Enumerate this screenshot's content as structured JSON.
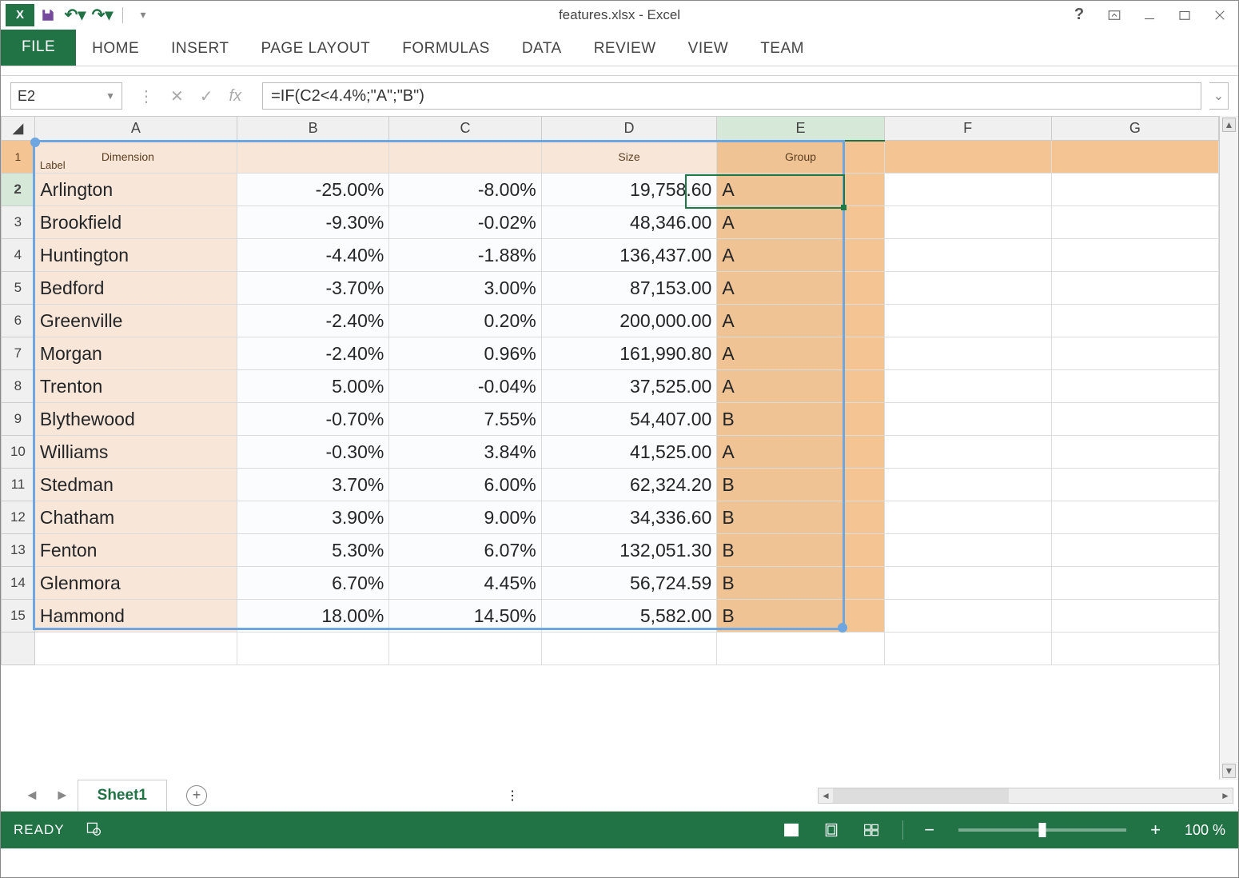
{
  "window": {
    "title": "features.xlsx - Excel"
  },
  "qat": {
    "save": "Save",
    "undo": "Undo",
    "redo": "Redo"
  },
  "titlebar_buttons": {
    "help": "?",
    "ribbon_opts": "Ribbon Display Options",
    "min": "Minimize",
    "restore": "Restore",
    "close": "Close"
  },
  "ribbon": {
    "tabs": [
      "FILE",
      "HOME",
      "INSERT",
      "PAGE LAYOUT",
      "FORMULAS",
      "DATA",
      "REVIEW",
      "VIEW",
      "TEAM"
    ]
  },
  "formula": {
    "name_box": "E2",
    "fx_label": "fx",
    "bar": "=IF(C2<4.4%;\"A\";\"B\")"
  },
  "columns": [
    "A",
    "B",
    "C",
    "D",
    "E",
    "F",
    "G"
  ],
  "header_row": {
    "label": "Label",
    "dimension": "Dimension",
    "size": "Size",
    "group": "Group"
  },
  "rows": [
    {
      "n": 2,
      "label": "Arlington",
      "b": "-25.00%",
      "c": "-8.00%",
      "d": "19,758.60",
      "e": "A"
    },
    {
      "n": 3,
      "label": "Brookfield",
      "b": "-9.30%",
      "c": "-0.02%",
      "d": "48,346.00",
      "e": "A"
    },
    {
      "n": 4,
      "label": "Huntington",
      "b": "-4.40%",
      "c": "-1.88%",
      "d": "136,437.00",
      "e": "A"
    },
    {
      "n": 5,
      "label": "Bedford",
      "b": "-3.70%",
      "c": "3.00%",
      "d": "87,153.00",
      "e": "A"
    },
    {
      "n": 6,
      "label": "Greenville",
      "b": "-2.40%",
      "c": "0.20%",
      "d": "200,000.00",
      "e": "A"
    },
    {
      "n": 7,
      "label": "Morgan",
      "b": "-2.40%",
      "c": "0.96%",
      "d": "161,990.80",
      "e": "A"
    },
    {
      "n": 8,
      "label": "Trenton",
      "b": "5.00%",
      "c": "-0.04%",
      "d": "37,525.00",
      "e": "A"
    },
    {
      "n": 9,
      "label": "Blythewood",
      "b": "-0.70%",
      "c": "7.55%",
      "d": "54,407.00",
      "e": "B"
    },
    {
      "n": 10,
      "label": "Williams",
      "b": "-0.30%",
      "c": "3.84%",
      "d": "41,525.00",
      "e": "A"
    },
    {
      "n": 11,
      "label": "Stedman",
      "b": "3.70%",
      "c": "6.00%",
      "d": "62,324.20",
      "e": "B"
    },
    {
      "n": 12,
      "label": "Chatham",
      "b": "3.90%",
      "c": "9.00%",
      "d": "34,336.60",
      "e": "B"
    },
    {
      "n": 13,
      "label": "Fenton",
      "b": "5.30%",
      "c": "6.07%",
      "d": "132,051.30",
      "e": "B"
    },
    {
      "n": 14,
      "label": "Glenmora",
      "b": "6.70%",
      "c": "4.45%",
      "d": "56,724.59",
      "e": "B"
    },
    {
      "n": 15,
      "label": "Hammond",
      "b": "18.00%",
      "c": "14.50%",
      "d": "5,582.00",
      "e": "B"
    }
  ],
  "active_cell": "E2",
  "selection_range": "A1:E15",
  "sheet_tabs": {
    "active": "Sheet1"
  },
  "statusbar": {
    "status": "READY",
    "zoom": "100 %"
  }
}
